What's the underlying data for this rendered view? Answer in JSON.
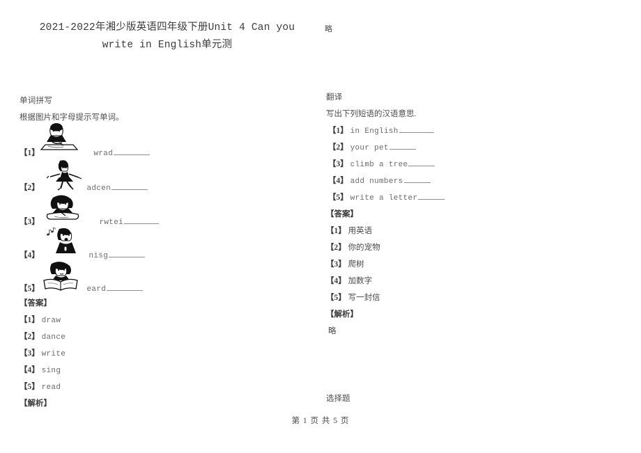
{
  "document": {
    "title_lines": [
      "2021-2022年湘少版英语四年级下册Unit 4 Can you",
      "write in English单元测"
    ],
    "corner_note": "略",
    "footer": "第 1 页 共 5 页"
  },
  "left_column": {
    "section_title": "单词拼写",
    "instruction": "根据图片和字母提示写单词。",
    "questions": [
      {
        "index": "【1】",
        "prompt": "wrad",
        "image": "child-drawing-picture"
      },
      {
        "index": "【2】",
        "prompt": "adcen",
        "image": "girl-dancing-picture"
      },
      {
        "index": "【3】",
        "prompt": "rwtei",
        "image": "girl-writing-picture"
      },
      {
        "index": "【4】",
        "prompt": "nisg",
        "image": "boy-singing-picture"
      },
      {
        "index": "【5】",
        "prompt": "eard",
        "image": "boy-reading-picture"
      }
    ],
    "answer_label": "【答案】",
    "answers": [
      {
        "index": "【1】",
        "text": "draw"
      },
      {
        "index": "【2】",
        "text": "dance"
      },
      {
        "index": "【3】",
        "text": "write"
      },
      {
        "index": "【4】",
        "text": "sing"
      },
      {
        "index": "【5】",
        "text": "read"
      }
    ],
    "analysis_label": "【解析】"
  },
  "right_column": {
    "section_title": "翻译",
    "instruction": "写出下列短语的汉语意思.",
    "questions": [
      {
        "index": "【1】",
        "text": "in English"
      },
      {
        "index": "【2】",
        "text": "your pet"
      },
      {
        "index": "【3】",
        "text": "climb a tree"
      },
      {
        "index": "【4】",
        "text": "add numbers"
      },
      {
        "index": "【5】",
        "text": "write a letter"
      }
    ],
    "answer_label": "【答案】",
    "answers": [
      {
        "index": "【1】",
        "text": "用英语"
      },
      {
        "index": "【2】",
        "text": "你的宠物"
      },
      {
        "index": "【3】",
        "text": "爬树"
      },
      {
        "index": "【4】",
        "text": "加数字"
      },
      {
        "index": "【5】",
        "text": "写一封信"
      }
    ],
    "analysis_label": "【解析】",
    "analysis_text": "略",
    "next_section_title": "选择题"
  }
}
